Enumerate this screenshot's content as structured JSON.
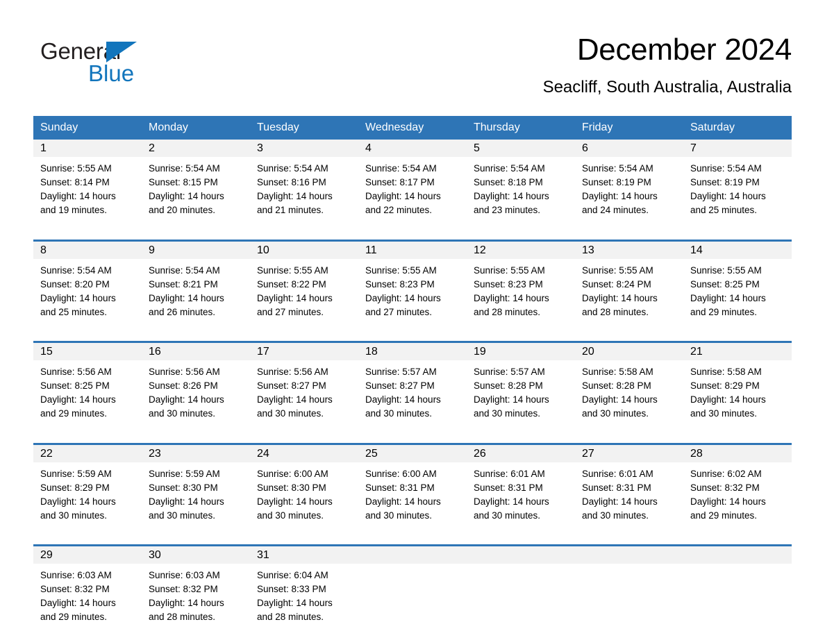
{
  "brand": {
    "name_part1": "General",
    "name_part2": "Blue",
    "triangle_icon": "triangle-icon",
    "accent_color": "#1275bc"
  },
  "header": {
    "month_title": "December 2024",
    "location": "Seacliff, South Australia, Australia"
  },
  "colors": {
    "header_blue": "#2e75b6",
    "day_band_gray": "#f2f2f2",
    "brand_blue": "#1275bc"
  },
  "calendar": {
    "weekday_headers": [
      "Sunday",
      "Monday",
      "Tuesday",
      "Wednesday",
      "Thursday",
      "Friday",
      "Saturday"
    ],
    "weeks": [
      [
        {
          "day": "1",
          "sunrise": "Sunrise: 5:55 AM",
          "sunset": "Sunset: 8:14 PM",
          "daylight_line1": "Daylight: 14 hours",
          "daylight_line2": "and 19 minutes."
        },
        {
          "day": "2",
          "sunrise": "Sunrise: 5:54 AM",
          "sunset": "Sunset: 8:15 PM",
          "daylight_line1": "Daylight: 14 hours",
          "daylight_line2": "and 20 minutes."
        },
        {
          "day": "3",
          "sunrise": "Sunrise: 5:54 AM",
          "sunset": "Sunset: 8:16 PM",
          "daylight_line1": "Daylight: 14 hours",
          "daylight_line2": "and 21 minutes."
        },
        {
          "day": "4",
          "sunrise": "Sunrise: 5:54 AM",
          "sunset": "Sunset: 8:17 PM",
          "daylight_line1": "Daylight: 14 hours",
          "daylight_line2": "and 22 minutes."
        },
        {
          "day": "5",
          "sunrise": "Sunrise: 5:54 AM",
          "sunset": "Sunset: 8:18 PM",
          "daylight_line1": "Daylight: 14 hours",
          "daylight_line2": "and 23 minutes."
        },
        {
          "day": "6",
          "sunrise": "Sunrise: 5:54 AM",
          "sunset": "Sunset: 8:19 PM",
          "daylight_line1": "Daylight: 14 hours",
          "daylight_line2": "and 24 minutes."
        },
        {
          "day": "7",
          "sunrise": "Sunrise: 5:54 AM",
          "sunset": "Sunset: 8:19 PM",
          "daylight_line1": "Daylight: 14 hours",
          "daylight_line2": "and 25 minutes."
        }
      ],
      [
        {
          "day": "8",
          "sunrise": "Sunrise: 5:54 AM",
          "sunset": "Sunset: 8:20 PM",
          "daylight_line1": "Daylight: 14 hours",
          "daylight_line2": "and 25 minutes."
        },
        {
          "day": "9",
          "sunrise": "Sunrise: 5:54 AM",
          "sunset": "Sunset: 8:21 PM",
          "daylight_line1": "Daylight: 14 hours",
          "daylight_line2": "and 26 minutes."
        },
        {
          "day": "10",
          "sunrise": "Sunrise: 5:55 AM",
          "sunset": "Sunset: 8:22 PM",
          "daylight_line1": "Daylight: 14 hours",
          "daylight_line2": "and 27 minutes."
        },
        {
          "day": "11",
          "sunrise": "Sunrise: 5:55 AM",
          "sunset": "Sunset: 8:23 PM",
          "daylight_line1": "Daylight: 14 hours",
          "daylight_line2": "and 27 minutes."
        },
        {
          "day": "12",
          "sunrise": "Sunrise: 5:55 AM",
          "sunset": "Sunset: 8:23 PM",
          "daylight_line1": "Daylight: 14 hours",
          "daylight_line2": "and 28 minutes."
        },
        {
          "day": "13",
          "sunrise": "Sunrise: 5:55 AM",
          "sunset": "Sunset: 8:24 PM",
          "daylight_line1": "Daylight: 14 hours",
          "daylight_line2": "and 28 minutes."
        },
        {
          "day": "14",
          "sunrise": "Sunrise: 5:55 AM",
          "sunset": "Sunset: 8:25 PM",
          "daylight_line1": "Daylight: 14 hours",
          "daylight_line2": "and 29 minutes."
        }
      ],
      [
        {
          "day": "15",
          "sunrise": "Sunrise: 5:56 AM",
          "sunset": "Sunset: 8:25 PM",
          "daylight_line1": "Daylight: 14 hours",
          "daylight_line2": "and 29 minutes."
        },
        {
          "day": "16",
          "sunrise": "Sunrise: 5:56 AM",
          "sunset": "Sunset: 8:26 PM",
          "daylight_line1": "Daylight: 14 hours",
          "daylight_line2": "and 30 minutes."
        },
        {
          "day": "17",
          "sunrise": "Sunrise: 5:56 AM",
          "sunset": "Sunset: 8:27 PM",
          "daylight_line1": "Daylight: 14 hours",
          "daylight_line2": "and 30 minutes."
        },
        {
          "day": "18",
          "sunrise": "Sunrise: 5:57 AM",
          "sunset": "Sunset: 8:27 PM",
          "daylight_line1": "Daylight: 14 hours",
          "daylight_line2": "and 30 minutes."
        },
        {
          "day": "19",
          "sunrise": "Sunrise: 5:57 AM",
          "sunset": "Sunset: 8:28 PM",
          "daylight_line1": "Daylight: 14 hours",
          "daylight_line2": "and 30 minutes."
        },
        {
          "day": "20",
          "sunrise": "Sunrise: 5:58 AM",
          "sunset": "Sunset: 8:28 PM",
          "daylight_line1": "Daylight: 14 hours",
          "daylight_line2": "and 30 minutes."
        },
        {
          "day": "21",
          "sunrise": "Sunrise: 5:58 AM",
          "sunset": "Sunset: 8:29 PM",
          "daylight_line1": "Daylight: 14 hours",
          "daylight_line2": "and 30 minutes."
        }
      ],
      [
        {
          "day": "22",
          "sunrise": "Sunrise: 5:59 AM",
          "sunset": "Sunset: 8:29 PM",
          "daylight_line1": "Daylight: 14 hours",
          "daylight_line2": "and 30 minutes."
        },
        {
          "day": "23",
          "sunrise": "Sunrise: 5:59 AM",
          "sunset": "Sunset: 8:30 PM",
          "daylight_line1": "Daylight: 14 hours",
          "daylight_line2": "and 30 minutes."
        },
        {
          "day": "24",
          "sunrise": "Sunrise: 6:00 AM",
          "sunset": "Sunset: 8:30 PM",
          "daylight_line1": "Daylight: 14 hours",
          "daylight_line2": "and 30 minutes."
        },
        {
          "day": "25",
          "sunrise": "Sunrise: 6:00 AM",
          "sunset": "Sunset: 8:31 PM",
          "daylight_line1": "Daylight: 14 hours",
          "daylight_line2": "and 30 minutes."
        },
        {
          "day": "26",
          "sunrise": "Sunrise: 6:01 AM",
          "sunset": "Sunset: 8:31 PM",
          "daylight_line1": "Daylight: 14 hours",
          "daylight_line2": "and 30 minutes."
        },
        {
          "day": "27",
          "sunrise": "Sunrise: 6:01 AM",
          "sunset": "Sunset: 8:31 PM",
          "daylight_line1": "Daylight: 14 hours",
          "daylight_line2": "and 30 minutes."
        },
        {
          "day": "28",
          "sunrise": "Sunrise: 6:02 AM",
          "sunset": "Sunset: 8:32 PM",
          "daylight_line1": "Daylight: 14 hours",
          "daylight_line2": "and 29 minutes."
        }
      ],
      [
        {
          "day": "29",
          "sunrise": "Sunrise: 6:03 AM",
          "sunset": "Sunset: 8:32 PM",
          "daylight_line1": "Daylight: 14 hours",
          "daylight_line2": "and 29 minutes."
        },
        {
          "day": "30",
          "sunrise": "Sunrise: 6:03 AM",
          "sunset": "Sunset: 8:32 PM",
          "daylight_line1": "Daylight: 14 hours",
          "daylight_line2": "and 28 minutes."
        },
        {
          "day": "31",
          "sunrise": "Sunrise: 6:04 AM",
          "sunset": "Sunset: 8:33 PM",
          "daylight_line1": "Daylight: 14 hours",
          "daylight_line2": "and 28 minutes."
        },
        {
          "day": "",
          "sunrise": "",
          "sunset": "",
          "daylight_line1": "",
          "daylight_line2": ""
        },
        {
          "day": "",
          "sunrise": "",
          "sunset": "",
          "daylight_line1": "",
          "daylight_line2": ""
        },
        {
          "day": "",
          "sunrise": "",
          "sunset": "",
          "daylight_line1": "",
          "daylight_line2": ""
        },
        {
          "day": "",
          "sunrise": "",
          "sunset": "",
          "daylight_line1": "",
          "daylight_line2": ""
        }
      ]
    ]
  }
}
